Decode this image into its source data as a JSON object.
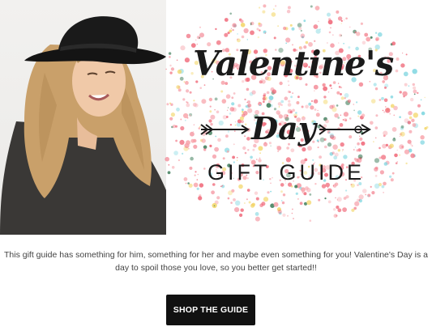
{
  "banner": {
    "title_script": "Valentine's",
    "title_day": "Day",
    "title_gift": "GIFT GUIDE",
    "accent_colors": [
      "#f06a7a",
      "#f7a1a8",
      "#7fd6e0",
      "#f3d76b",
      "#3b7a57"
    ]
  },
  "content": {
    "description": "This gift guide has something for him, something for her and maybe even something for you! Valentine's Day is a day to spoil those you love, so you better get started!!"
  },
  "cta": {
    "label": "SHOP THE GUIDE"
  }
}
